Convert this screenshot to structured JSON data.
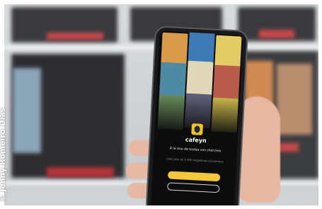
{
  "photo_credit": "© Jenny Romeiro Dias",
  "app": {
    "brand": "cafeyn",
    "tagline": "À la Une de toutes vos cherches",
    "subtitle": "Lisez plus de 5 000 magazines et journaux",
    "primary_button": "",
    "secondary_button": ""
  },
  "colors": {
    "accent": "#f6c73a",
    "screen_bg": "#0c0c0d",
    "logo_bg": "#f4c21e"
  }
}
